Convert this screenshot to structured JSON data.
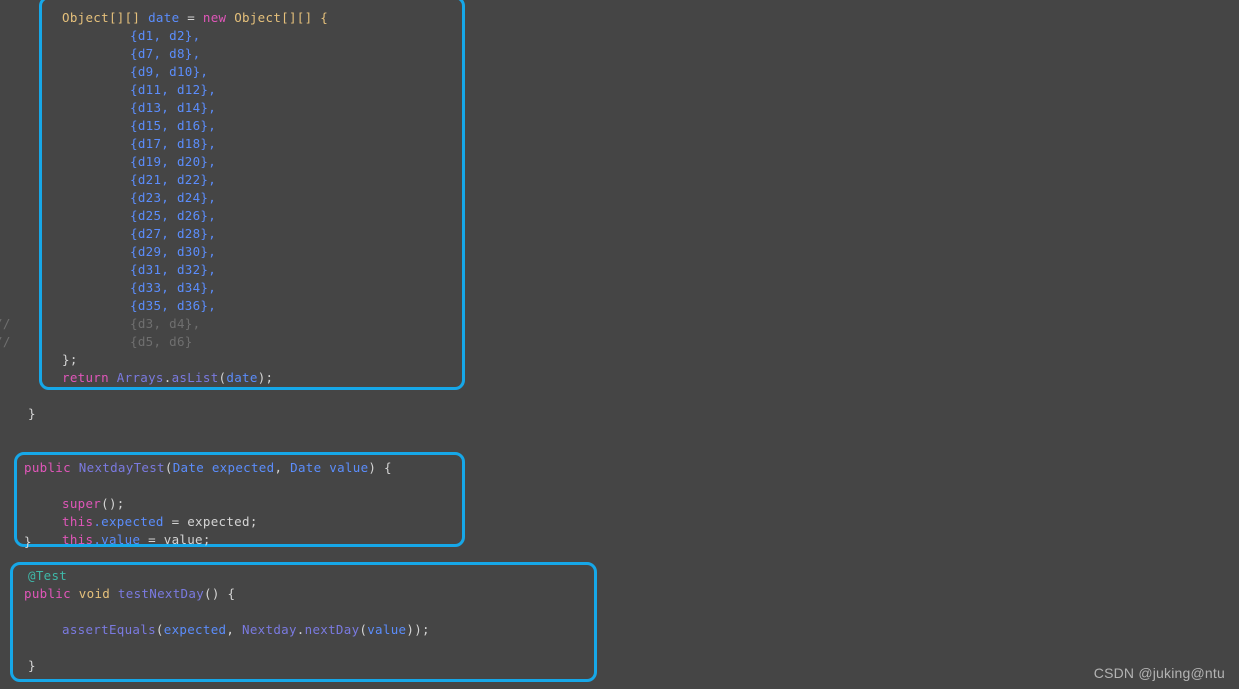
{
  "editor": {
    "background_color": "#454545",
    "highlight_border_color": "#16a7e8",
    "default_text_color": "#d4d4d4"
  },
  "blocks": [
    {
      "id": "data-provider-array",
      "highlighted": true,
      "lines": [
        "Object[][] date = new Object[][] {",
        "        {d1, d2},",
        "        {d7, d8},",
        "        {d9, d10},",
        "        {d11, d12},",
        "        {d13, d14},",
        "        {d15, d16},",
        "        {d17, d18},",
        "        {d19, d20},",
        "        {d21, d22},",
        "        {d23, d24},",
        "        {d25, d26},",
        "        {d27, d28},",
        "        {d29, d30},",
        "        {d31, d32},",
        "        {d33, d34},",
        "        {d35, d36},",
        "        {d3, d4},",
        "        {d5, d6}",
        "};",
        "return Arrays.asList(date);"
      ]
    },
    {
      "id": "constructor",
      "highlighted": true,
      "lines": [
        "public NextdayTest(Date expected, Date value) {",
        "    super();",
        "    this.expected = expected;",
        "    this.value = value;",
        "}"
      ]
    },
    {
      "id": "test-method",
      "highlighted": true,
      "lines": [
        "@Test",
        "public void testNextDay() {",
        "",
        "    assertEquals(expected, Nextday.nextDay(value));",
        "",
        "}"
      ]
    }
  ],
  "loose_text": {
    "closing_brace": "}",
    "comment_marker_1": "//",
    "comment_marker_2": "//"
  },
  "code_tokens": {
    "l1_type": "Object[][]",
    "l1_name": "date",
    "l1_eq": " = ",
    "l1_new": "new",
    "l1_type2": " Object[][] {",
    "rows": [
      "{d1, d2},",
      "{d7, d8},",
      "{d9, d10},",
      "{d11, d12},",
      "{d13, d14},",
      "{d15, d16},",
      "{d17, d18},",
      "{d19, d20},",
      "{d21, d22},",
      "{d23, d24},",
      "{d25, d26},",
      "{d27, d28},",
      "{d29, d30},",
      "{d31, d32},",
      "{d33, d34},",
      "{d35, d36},"
    ],
    "commented_rows": [
      "{d3, d4},",
      "{d5, d6}"
    ],
    "close_brace_semi": "};",
    "return_kw": "return",
    "arrays_call": " Arrays",
    "dot": ".",
    "aslist": "asList",
    "open_paren": "(",
    "date_arg": "date",
    "close_paren_semi": ");",
    "ctor_public": "public",
    "ctor_name": " NextdayTest",
    "ctor_p1": "(",
    "ctor_date1": "Date",
    "ctor_exp1": " expected",
    "ctor_comma": ", ",
    "ctor_date2": "Date",
    "ctor_val1": " value",
    "ctor_p2": ") {",
    "super_kw": "super",
    "super_rest": "();",
    "this_kw": "this",
    "this_expected": ".expected",
    "assign_expected": " = expected;",
    "this_value": ".value",
    "assign_value": " = value;",
    "brace_close": "}",
    "anno_test": "@Test",
    "m_public": "public",
    "m_void": " void",
    "m_name": " testNextDay",
    "m_sig": "() {",
    "assert_name": "assertEquals",
    "assert_open": "(",
    "assert_expected": "expected",
    "assert_comma": ", ",
    "assert_cls": "Nextday",
    "assert_dot": ".",
    "assert_method": "nextDay",
    "assert_open2": "(",
    "assert_value": "value",
    "assert_close": "));"
  },
  "watermark": {
    "text": "CSDN @juking@ntu"
  }
}
